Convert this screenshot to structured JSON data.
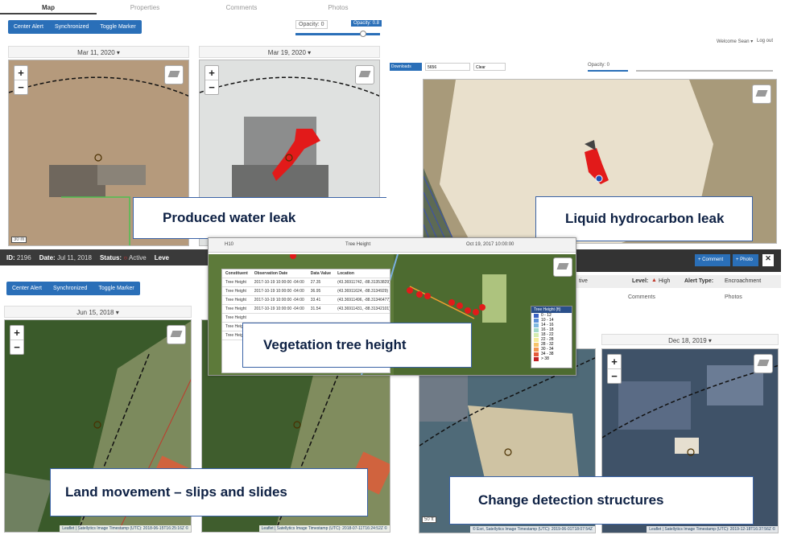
{
  "top_left": {
    "tabs": [
      "Map",
      "Properties",
      "Comments",
      "Photos"
    ],
    "buttons": [
      "Center Alert",
      "Synchronized",
      "Toggle Marker"
    ],
    "opacity_left": "Opacity: 0",
    "opacity_right": "Opacity: 0.8",
    "date_left": "Mar 11, 2020",
    "date_right": "Mar 19, 2020",
    "scale": "30 m",
    "label": "Produced water leak"
  },
  "status_bar": {
    "id_label": "ID:",
    "id_value": "2196",
    "date_label": "Date:",
    "date_value": "Jul 11, 2018",
    "status_label": "Status:",
    "status_value": "Active",
    "level_label": "Leve"
  },
  "top_right": {
    "welcome": "Welcome Sean ▾",
    "logout": "Log out",
    "downloads": "Downloads",
    "search": "5656",
    "clear": "Clear",
    "opacity": "Opacity: 0",
    "label": "Liquid hydrocarbon leak"
  },
  "middle": {
    "select1": "H10",
    "select2": "Tree Height",
    "select3": "Oct 19, 2017 10:00:00",
    "table_headers": [
      "Constituent",
      "Observation Date",
      "Data Value",
      "Location"
    ],
    "table_rows": [
      [
        "Tree Height",
        "2017-10-19 10:00:00 -04:00",
        "27.35",
        "(43.36911742, -88.31353829)"
      ],
      [
        "Tree Height",
        "2017-10-19 10:00:00 -04:00",
        "36.95",
        "(43.36911624, -88.3134929)"
      ],
      [
        "Tree Height",
        "2017-10-19 10:00:00 -04:00",
        "33.41",
        "(43.36911496, -88.31346477)"
      ],
      [
        "Tree Height",
        "2017-10-19 10:00:00 -04:00",
        "31.54",
        "(43.36911431, -88.31342101)"
      ],
      [
        "Tree Height",
        "",
        "",
        ""
      ],
      [
        "Tree Height",
        "",
        "",
        ""
      ],
      [
        "Tree Height",
        "",
        "",
        ""
      ]
    ],
    "legend_title": "Tree Height (ft)",
    "legend_ranges": [
      "0 - 12",
      "10 - 14",
      "14 - 16",
      "16 - 18",
      "18 - 22",
      "22 - 28",
      "28 - 32",
      "30 - 34",
      "34 - 38",
      "> 38"
    ],
    "legend_colors": [
      "#3a62c4",
      "#5c8fd8",
      "#7fb8e0",
      "#a3d9c9",
      "#d4ecb0",
      "#f4eb9a",
      "#f7c46a",
      "#f29550",
      "#e55a3a",
      "#c21f24"
    ],
    "label": "Vegetation tree height",
    "comment_btn": "+ Comment",
    "photo_btn": "+ Photo",
    "close": "✕",
    "status_partial": "tive",
    "level_label": "Level:",
    "level_value": "High",
    "alert_label": "Alert Type:",
    "alert_value": "Encroachment",
    "tab_comments": "Comments",
    "tab_photos": "Photos"
  },
  "bottom_left": {
    "buttons": [
      "Center Alert",
      "Synchronized",
      "Toggle Marker"
    ],
    "date": "Jun 15, 2018",
    "attr_left": "Leaflet | Satellytics Image Timestamp (UTC): 2018-06-15T16:25:16Z ©",
    "attr_right": "Leaflet | Satellytics Image Timestamp (UTC): 2018-07-11T16:24:52Z ©",
    "label": "Land movement – slips and slides"
  },
  "bottom_right": {
    "date": "Dec 18, 2019",
    "scale": "50 ft",
    "attr_left": "© Esri, Satellytics Image Timestamp (UTC): 2019-06-01T18:07:54Z",
    "attr_right": "Leaflet | Satellytics Image Timestamp (UTC): 2019-12-18T16:37:56Z ©",
    "label": "Change detection structures"
  }
}
